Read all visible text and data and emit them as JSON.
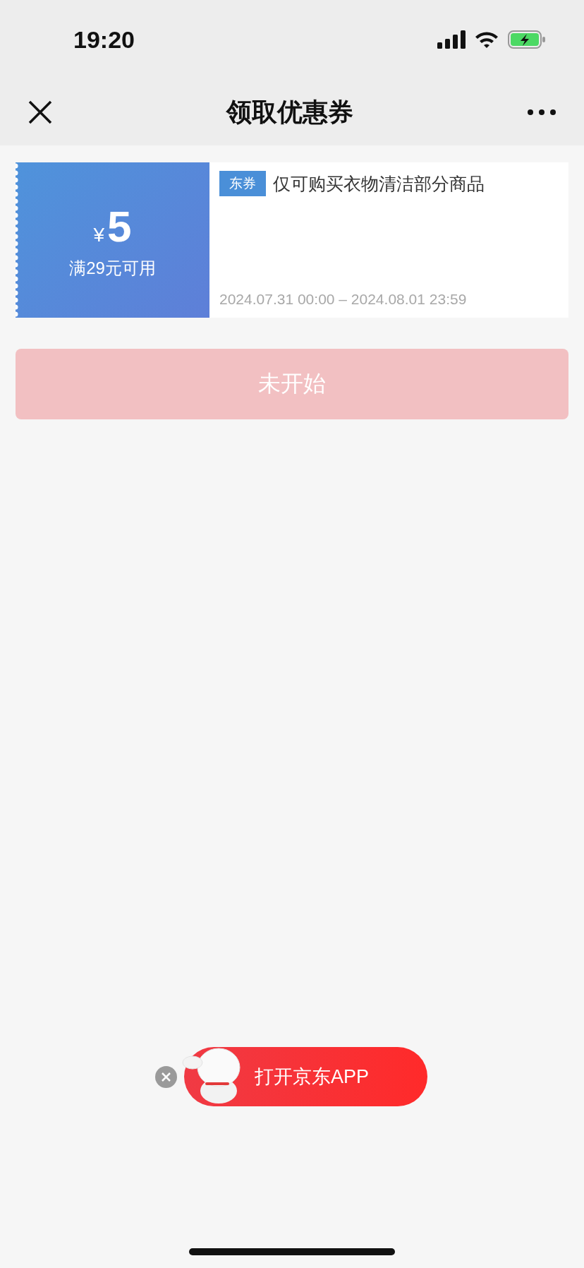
{
  "status_bar": {
    "time": "19:20",
    "battery_charging": true
  },
  "nav": {
    "title": "领取优惠券"
  },
  "coupon": {
    "currency": "¥",
    "amount": "5",
    "condition": "满29元可用",
    "tag": "东券",
    "description": "仅可购买衣物清洁部分商品",
    "validity": "2024.07.31 00:00 – 2024.08.01 23:59"
  },
  "claim_button": {
    "label": "未开始",
    "disabled": true
  },
  "app_banner": {
    "label": "打开京东APP"
  }
}
